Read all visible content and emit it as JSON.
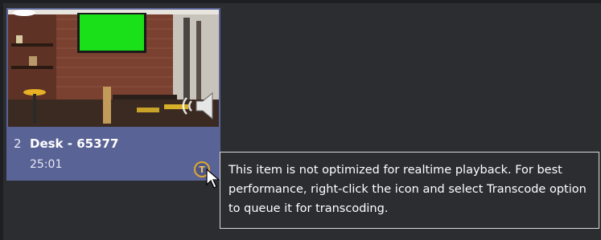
{
  "media_item": {
    "index": "2",
    "title": "Desk - 65377",
    "duration": "25:01",
    "transcode_badge": "T",
    "thumbnail_icon": "audio-speaker-icon",
    "accent_color": "#5a6395",
    "badge_color": "#e0a82e"
  },
  "tooltip": {
    "text": "This item is not optimized for realtime playback. For best performance, right-click the icon and select Transcode option to queue it for transcoding."
  }
}
